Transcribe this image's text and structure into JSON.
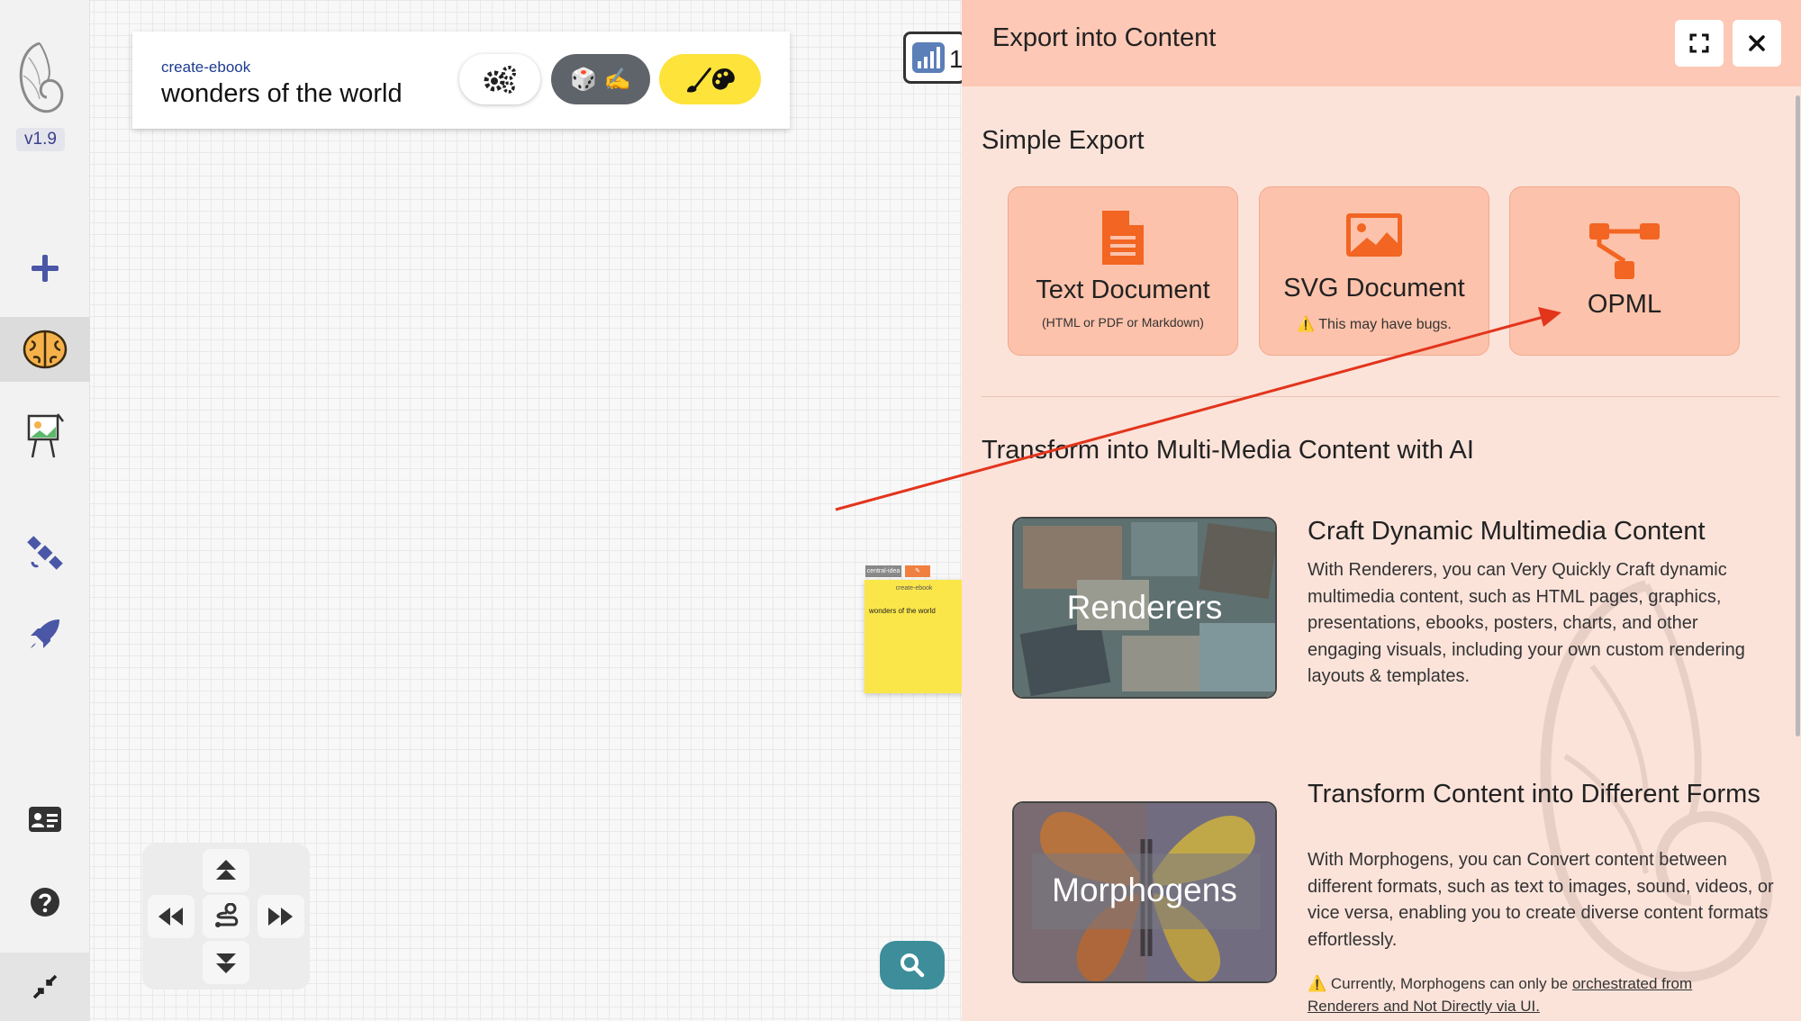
{
  "app": {
    "version": "v1.9"
  },
  "top_card": {
    "tag": "create-ebook",
    "title": "wonders of the world",
    "dice_pill_emoji": "🎲 ✍️"
  },
  "partial_chip": {
    "number": "1"
  },
  "note": {
    "tag_left": "central-idea",
    "tag_right": "✎",
    "tag": "create-ebook",
    "text": "wonders of the world"
  },
  "panel": {
    "title": "Export into Content",
    "simple_export_title": "Simple Export",
    "cards": [
      {
        "label": "Text Document",
        "sub": "(HTML or PDF or Markdown)",
        "icon": "file-text-icon"
      },
      {
        "label": "SVG Document",
        "sub": "⚠️ This may have bugs.",
        "icon": "image-icon"
      },
      {
        "label": "OPML",
        "icon": "sitemap-icon"
      }
    ],
    "ai_section_title": "Transform into Multi-Media Content with AI",
    "renderers": {
      "image_label": "Renderers",
      "title": "Craft Dynamic Multimedia Content",
      "description": "With Renderers, you can Very Quickly Craft dynamic multimedia content, such as HTML pages, graphics, presentations, ebooks, posters, charts, and other engaging visuals, including your own custom rendering layouts & templates."
    },
    "morphogens": {
      "image_label": "Morphogens",
      "title": "Transform Content into Different Forms",
      "description": "With Morphogens, you can Convert content between different formats, such as text to images, sound, videos, or vice versa, enabling you to create diverse content formats effortlessly.",
      "warning_prefix": "⚠️ Currently, Morphogens can only be ",
      "warning_link": "orchestrated from Renderers and Not Directly via UI."
    }
  },
  "colors": {
    "accent_orange": "#f26522",
    "card_bg": "#fdc2ab",
    "panel_bg": "#fbe3da",
    "header_bg": "#fdc8b5",
    "sidebar_icon": "#4a56a6",
    "annotation_arrow": "#e3341c"
  }
}
